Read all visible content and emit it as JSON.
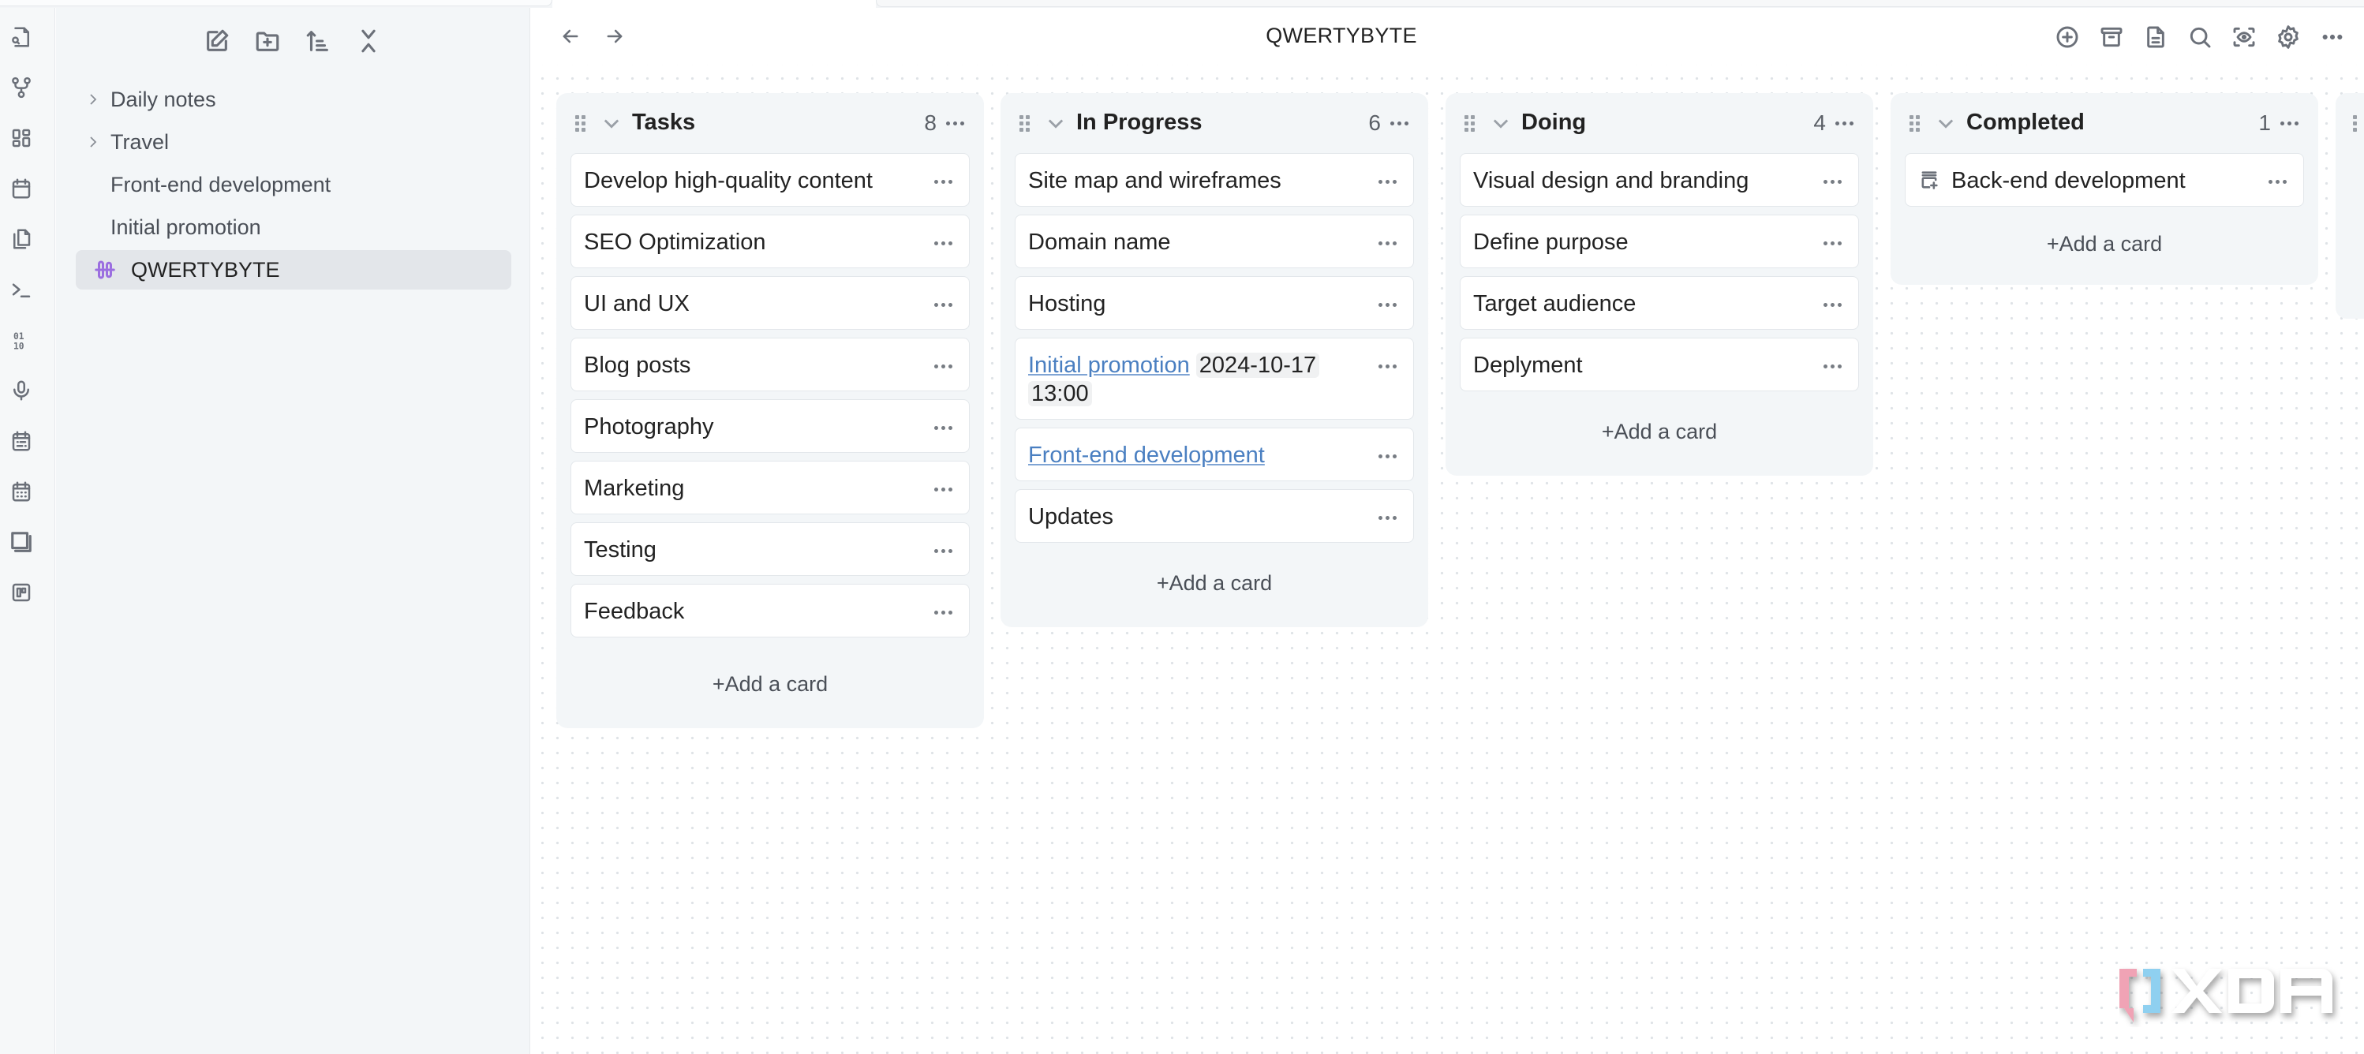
{
  "window": {
    "view_title": "QWERTYBYTE"
  },
  "ribbon": {
    "icons": [
      "search-file-icon",
      "graph-view-icon",
      "dashboard-icon",
      "calendar-icon",
      "copy-files-icon",
      "terminal-icon",
      "binary-icon",
      "microphone-icon",
      "calendar-list-icon",
      "calendar-grid-icon",
      "slides-icon",
      "kanban-icon"
    ]
  },
  "sidebar": {
    "toolbar": [
      "new-note",
      "new-folder",
      "sort",
      "collapse-all"
    ],
    "items": [
      {
        "label": "Daily notes",
        "type": "folder"
      },
      {
        "label": "Travel",
        "type": "folder"
      },
      {
        "label": "Front-end development",
        "type": "file"
      },
      {
        "label": "Initial promotion",
        "type": "file"
      },
      {
        "label": "QWERTYBYTE",
        "type": "kanban",
        "active": true
      }
    ]
  },
  "header": {
    "actions": [
      "add-lane",
      "archive",
      "open-as-markdown",
      "search",
      "view-mode",
      "board-settings",
      "more-options"
    ]
  },
  "board": {
    "add_card_label": "+Add a card",
    "lanes": [
      {
        "title": "Tasks",
        "count": "8",
        "cards": [
          {
            "text": "Develop high-quality content"
          },
          {
            "text": "SEO Optimization"
          },
          {
            "text": "UI and UX"
          },
          {
            "text": "Blog posts"
          },
          {
            "text": "Photography"
          },
          {
            "text": "Marketing"
          },
          {
            "text": "Testing"
          },
          {
            "text": "Feedback"
          }
        ]
      },
      {
        "title": "In Progress",
        "count": "6",
        "cards": [
          {
            "text": "Site map and wireframes"
          },
          {
            "text": "Domain name"
          },
          {
            "text": "Hosting"
          },
          {
            "link": "Initial promotion",
            "date": "2024-10-17",
            "time": "13:00"
          },
          {
            "link": "Front-end development"
          },
          {
            "text": "Updates"
          }
        ]
      },
      {
        "title": "Doing",
        "count": "4",
        "cards": [
          {
            "text": "Visual design and branding"
          },
          {
            "text": "Define purpose"
          },
          {
            "text": "Target audience"
          },
          {
            "text": "Deplyment"
          }
        ]
      },
      {
        "title": "Completed",
        "count": "1",
        "cards": [
          {
            "text": "Back-end development",
            "icon": "archive-card-icon"
          }
        ]
      }
    ]
  },
  "watermark": {
    "text": "XDA"
  },
  "colors": {
    "accent": "#9b6ee0",
    "link": "#4a7fc1",
    "lane_bg": "#f3f6f8"
  }
}
